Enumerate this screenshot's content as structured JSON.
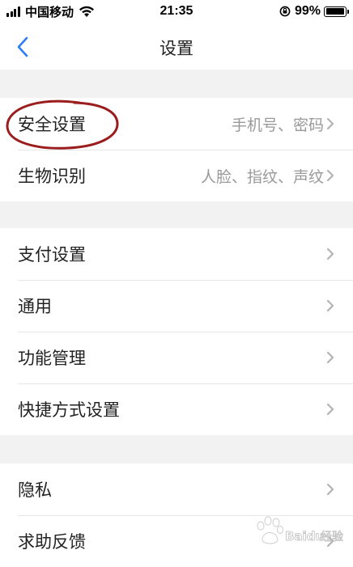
{
  "status_bar": {
    "carrier": "中国移动",
    "time": "21:35",
    "battery": "99%",
    "battery_level": 0.99
  },
  "nav": {
    "title": "设置",
    "back_icon": "chevron-left-icon"
  },
  "groups": [
    {
      "rows": [
        {
          "label": "安全设置",
          "value": "手机号、密码"
        },
        {
          "label": "生物识别",
          "value": "人脸、指纹、声纹"
        }
      ]
    },
    {
      "rows": [
        {
          "label": "支付设置",
          "value": ""
        },
        {
          "label": "通用",
          "value": ""
        },
        {
          "label": "功能管理",
          "value": ""
        },
        {
          "label": "快捷方式设置",
          "value": ""
        }
      ]
    },
    {
      "rows": [
        {
          "label": "隐私",
          "value": ""
        },
        {
          "label": "求助反馈",
          "value": ""
        }
      ]
    }
  ],
  "colors": {
    "accent": "#2f7df6",
    "highlight": "#9b1c1c",
    "separator": "#e6e6e6",
    "background": "#f2f2f2"
  },
  "watermark": {
    "brand": "Baidu",
    "suffix": "经验"
  }
}
